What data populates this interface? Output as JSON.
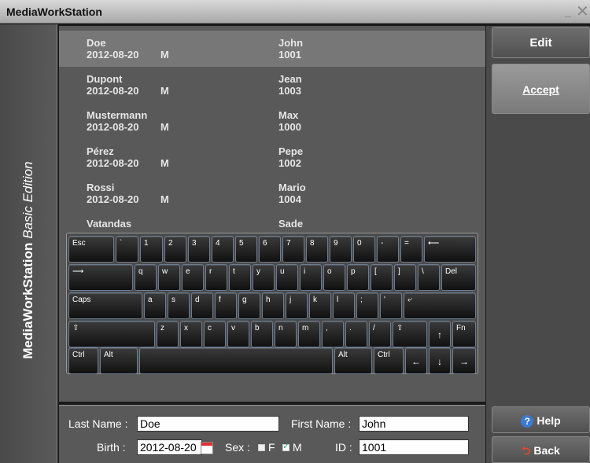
{
  "app_title": "MediaWorkStation",
  "window_controls": {
    "minimize": "_",
    "close": "✕"
  },
  "sidebar": {
    "brand": "MediaWorkStation",
    "edition": "Basic Edition"
  },
  "records": [
    {
      "last": "Doe",
      "date": "2012-08-20",
      "sex": "M",
      "first": "John",
      "id": "1001",
      "selected": true
    },
    {
      "last": "Dupont",
      "date": "2012-08-20",
      "sex": "M",
      "first": "Jean",
      "id": "1003"
    },
    {
      "last": "Mustermann",
      "date": "2012-08-20",
      "sex": "M",
      "first": "Max",
      "id": "1000"
    },
    {
      "last": "Pérez",
      "date": "2012-08-20",
      "sex": "M",
      "first": "Pepe",
      "id": "1002"
    },
    {
      "last": "Rossi",
      "date": "2012-08-20",
      "sex": "M",
      "first": "Mario",
      "id": "1004"
    },
    {
      "last": "Vatandas",
      "date": "",
      "sex": "",
      "first": "Sade",
      "id": ""
    }
  ],
  "form": {
    "last_name_label": "Last Name :",
    "last_name_value": "Doe",
    "first_name_label": "First Name :",
    "first_name_value": "John",
    "birth_label": "Birth :",
    "birth_value": "2012-08-20",
    "sex_label": "Sex :",
    "sex_f": "F",
    "sex_m": "M",
    "sex_selected": "M",
    "id_label": "ID :",
    "id_value": "1001"
  },
  "actions": {
    "edit": "Edit",
    "accept": "Accept",
    "help": "Help",
    "back": "Back"
  },
  "keyboard": {
    "rows": [
      [
        "Esc",
        "`",
        "1",
        "2",
        "3",
        "4",
        "5",
        "6",
        "7",
        "8",
        "9",
        "0",
        "-",
        "=",
        "⟵"
      ],
      [
        "⟶",
        "q",
        "w",
        "e",
        "r",
        "t",
        "y",
        "u",
        "i",
        "o",
        "p",
        "[",
        "]",
        "\\",
        "Del"
      ],
      [
        "Caps",
        "a",
        "s",
        "d",
        "f",
        "g",
        "h",
        "j",
        "k",
        "l",
        ";",
        "'",
        "⤶"
      ],
      [
        "⇧",
        "z",
        "x",
        "c",
        "v",
        "b",
        "n",
        "m",
        ",",
        ".",
        "/",
        "⇧",
        "↑",
        "Fn"
      ],
      [
        "Ctrl",
        "Alt",
        "",
        "Alt",
        "Ctrl",
        "←",
        "↓",
        "→"
      ]
    ]
  }
}
